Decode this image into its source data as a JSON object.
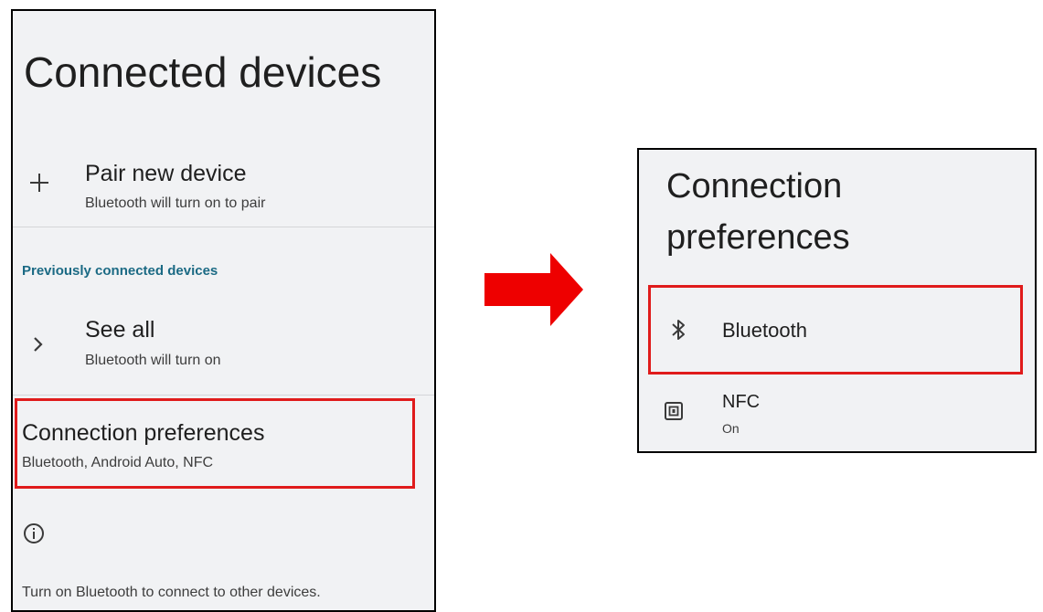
{
  "left_screen": {
    "title": "Connected devices",
    "pair_new_device": {
      "title": "Pair new device",
      "subtitle": "Bluetooth will turn on to pair"
    },
    "section_label": "Previously connected devices",
    "see_all": {
      "title": "See all",
      "subtitle": "Bluetooth will turn on"
    },
    "connection_preferences": {
      "title": "Connection preferences",
      "subtitle": "Bluetooth, Android Auto, NFC"
    },
    "footer_text": "Turn on Bluetooth to connect to other devices."
  },
  "right_screen": {
    "title_line1": "Connection",
    "title_line2": "preferences",
    "bluetooth": {
      "title": "Bluetooth"
    },
    "nfc": {
      "title": "NFC",
      "subtitle": "On"
    }
  },
  "icons": {
    "add": "plus-icon",
    "chevron": "chevron-right-icon",
    "info": "info-icon",
    "bluetooth": "bluetooth-icon",
    "nfc": "nfc-icon",
    "arrow": "arrow-right-icon"
  },
  "colors": {
    "highlight": "#e01b1b",
    "arrow": "#ee0000",
    "section_label": "#1b6a84",
    "panel_background": "#f1f2f4"
  }
}
